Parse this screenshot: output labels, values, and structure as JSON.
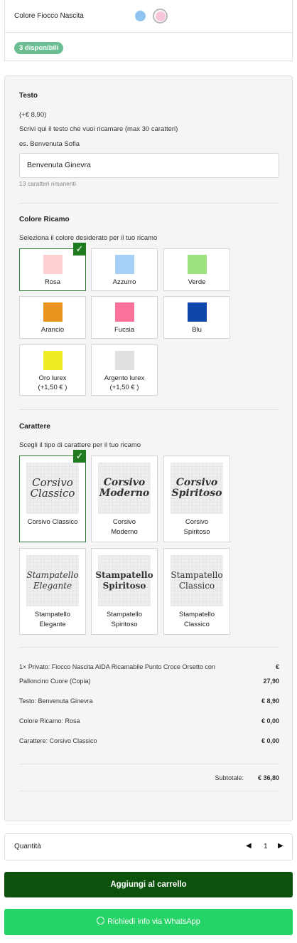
{
  "color_option": {
    "label": "Colore Fiocco Nascita",
    "swatches": [
      "#8fc4f0",
      "#f6c5d9"
    ]
  },
  "stock_badge": "3 disponibili",
  "text_section": {
    "title": "Testo",
    "price": "(+€ 8,90)",
    "instructions": "Scrivi qui il testo che vuoi ricamare (max 30 caratteri)",
    "example": "es. Benvenuta Sofia",
    "input_value": "Benvenuta Ginevra",
    "remaining": "13 caratteri rimanenti"
  },
  "embroidery_color": {
    "title": "Colore Ricamo",
    "instructions": "Seleziona il colore desiderato per il tuo ricamo",
    "options": [
      {
        "label": "Rosa",
        "color": "#fccfd1"
      },
      {
        "label": "Azzurro",
        "color": "#a7d0f7"
      },
      {
        "label": "Verde",
        "color": "#9de27d"
      },
      {
        "label": "Arancio",
        "color": "#e8951f"
      },
      {
        "label": "Fucsia",
        "color": "#fb7199"
      },
      {
        "label": "Blu",
        "color": "#0c47a9"
      },
      {
        "label": "Oro lurex",
        "price": "(+1,50 € )",
        "color": "#f1eb25"
      },
      {
        "label": "Argento lurex",
        "price": "(+1,50 € )",
        "color": "#e0e0e0"
      }
    ],
    "selected": "Rosa"
  },
  "font_section": {
    "title": "Carattere",
    "instructions": "Scegli il tipo di carattere per il tuo ricamo",
    "options": [
      {
        "label": "Corsivo Classico",
        "preview": "Corsivo\nClassico"
      },
      {
        "label": "Corsivo\nModerno",
        "preview": "Corsivo\nModerno"
      },
      {
        "label": "Corsivo\nSpiritoso",
        "preview": "Corsivo\nSpiritoso"
      },
      {
        "label": "Stampatello\nElegante",
        "preview": "Stampatello\nElegante"
      },
      {
        "label": "Stampatello\nSpiritoso",
        "preview": "Stampatello\nSpiritoso"
      },
      {
        "label": "Stampatello\nClassico",
        "preview": "Stampatello\nClassico"
      }
    ],
    "selected": "Corsivo Classico"
  },
  "summary": {
    "product_line": "1× Privato: Fiocco Nascita AIDA Ricamabile Punto Croce Orsetto con Palloncino Cuore (Copia)",
    "product_price_symbol": "€",
    "product_price": "27,90",
    "lines": [
      {
        "label": "Testo: Benvenuta Ginevra",
        "value": "€ 8,90"
      },
      {
        "label": "Colore Ricamo: Rosa",
        "value": "€ 0,00"
      },
      {
        "label": "Carattere: Corsivo Classico",
        "value": "€ 0,00"
      }
    ],
    "subtotal_label": "Subtotale:",
    "subtotal_value": "€ 36,80"
  },
  "quantity": {
    "label": "Quantità",
    "value": "1",
    "decrement_icon": "triangle-left-icon",
    "increment_icon": "triangle-right-icon"
  },
  "buttons": {
    "add_to_cart": "Aggiungi al carrello",
    "whatsapp": "Richiedi info via WhatsApp"
  }
}
